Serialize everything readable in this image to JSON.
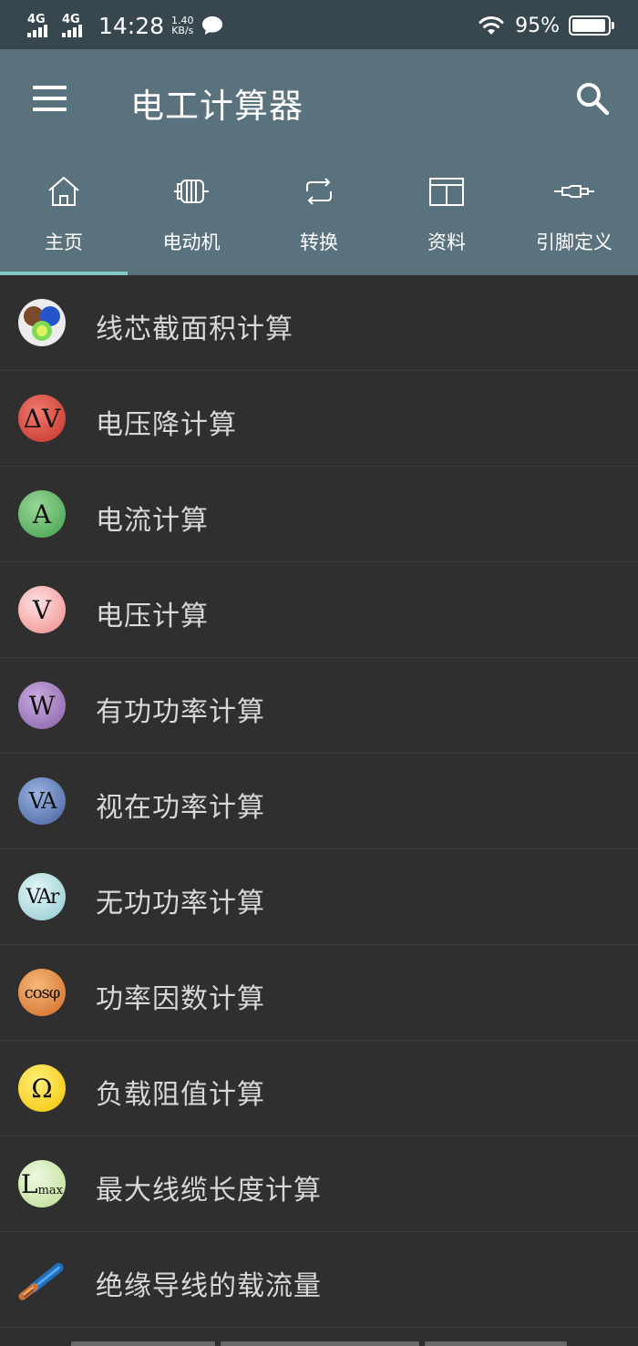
{
  "status_bar": {
    "network_1": "4G",
    "network_2": "4G",
    "time": "14:28",
    "speed_value": "1.40",
    "speed_unit": "KB/s",
    "battery_percent": "95%",
    "battery_level": 0.95
  },
  "app_bar": {
    "title": "电工计算器",
    "menu_icon": "hamburger-menu-icon",
    "search_icon": "search-icon"
  },
  "tabs": [
    {
      "label": "主页",
      "icon": "home-icon",
      "selected": true
    },
    {
      "label": "电动机",
      "icon": "motor-icon",
      "selected": false
    },
    {
      "label": "转换",
      "icon": "convert-icon",
      "selected": false
    },
    {
      "label": "资料",
      "icon": "table-icon",
      "selected": false
    },
    {
      "label": "引脚定义",
      "icon": "connector-plug-icon",
      "selected": false
    }
  ],
  "items": [
    {
      "label": "线芯截面积计算",
      "badge": "",
      "icon": "cable-cores-icon",
      "color": "#e0e0e0"
    },
    {
      "label": "电压降计算",
      "badge": "ΔV",
      "icon": "voltage-drop-icon",
      "color": "#d9473d"
    },
    {
      "label": "电流计算",
      "badge": "A",
      "icon": "current-icon",
      "color": "#5fb866"
    },
    {
      "label": "电压计算",
      "badge": "V",
      "icon": "voltage-icon",
      "color": "#f6a4a4"
    },
    {
      "label": "有功功率计算",
      "badge": "W",
      "icon": "active-power-icon",
      "color": "#9a77b9"
    },
    {
      "label": "视在功率计算",
      "badge": "VA",
      "icon": "apparent-power-icon",
      "color": "#5b78b5"
    },
    {
      "label": "无功功率计算",
      "badge": "VAr",
      "icon": "reactive-power-icon",
      "color": "#a9dbe0"
    },
    {
      "label": "功率因数计算",
      "badge": "cosφ",
      "icon": "power-factor-icon",
      "color": "#e58a3c"
    },
    {
      "label": "负载阻值计算",
      "badge": "Ω",
      "icon": "load-resistance-icon",
      "color": "#f7d21e"
    },
    {
      "label": "最大线缆长度计算",
      "badge": "L",
      "badge_sub": "max",
      "icon": "max-cable-length-icon",
      "color": "#cde5b0"
    },
    {
      "label": "绝缘导线的载流量",
      "badge": "",
      "icon": "insulated-wire-icon",
      "color": "#2f7fc8"
    }
  ]
}
